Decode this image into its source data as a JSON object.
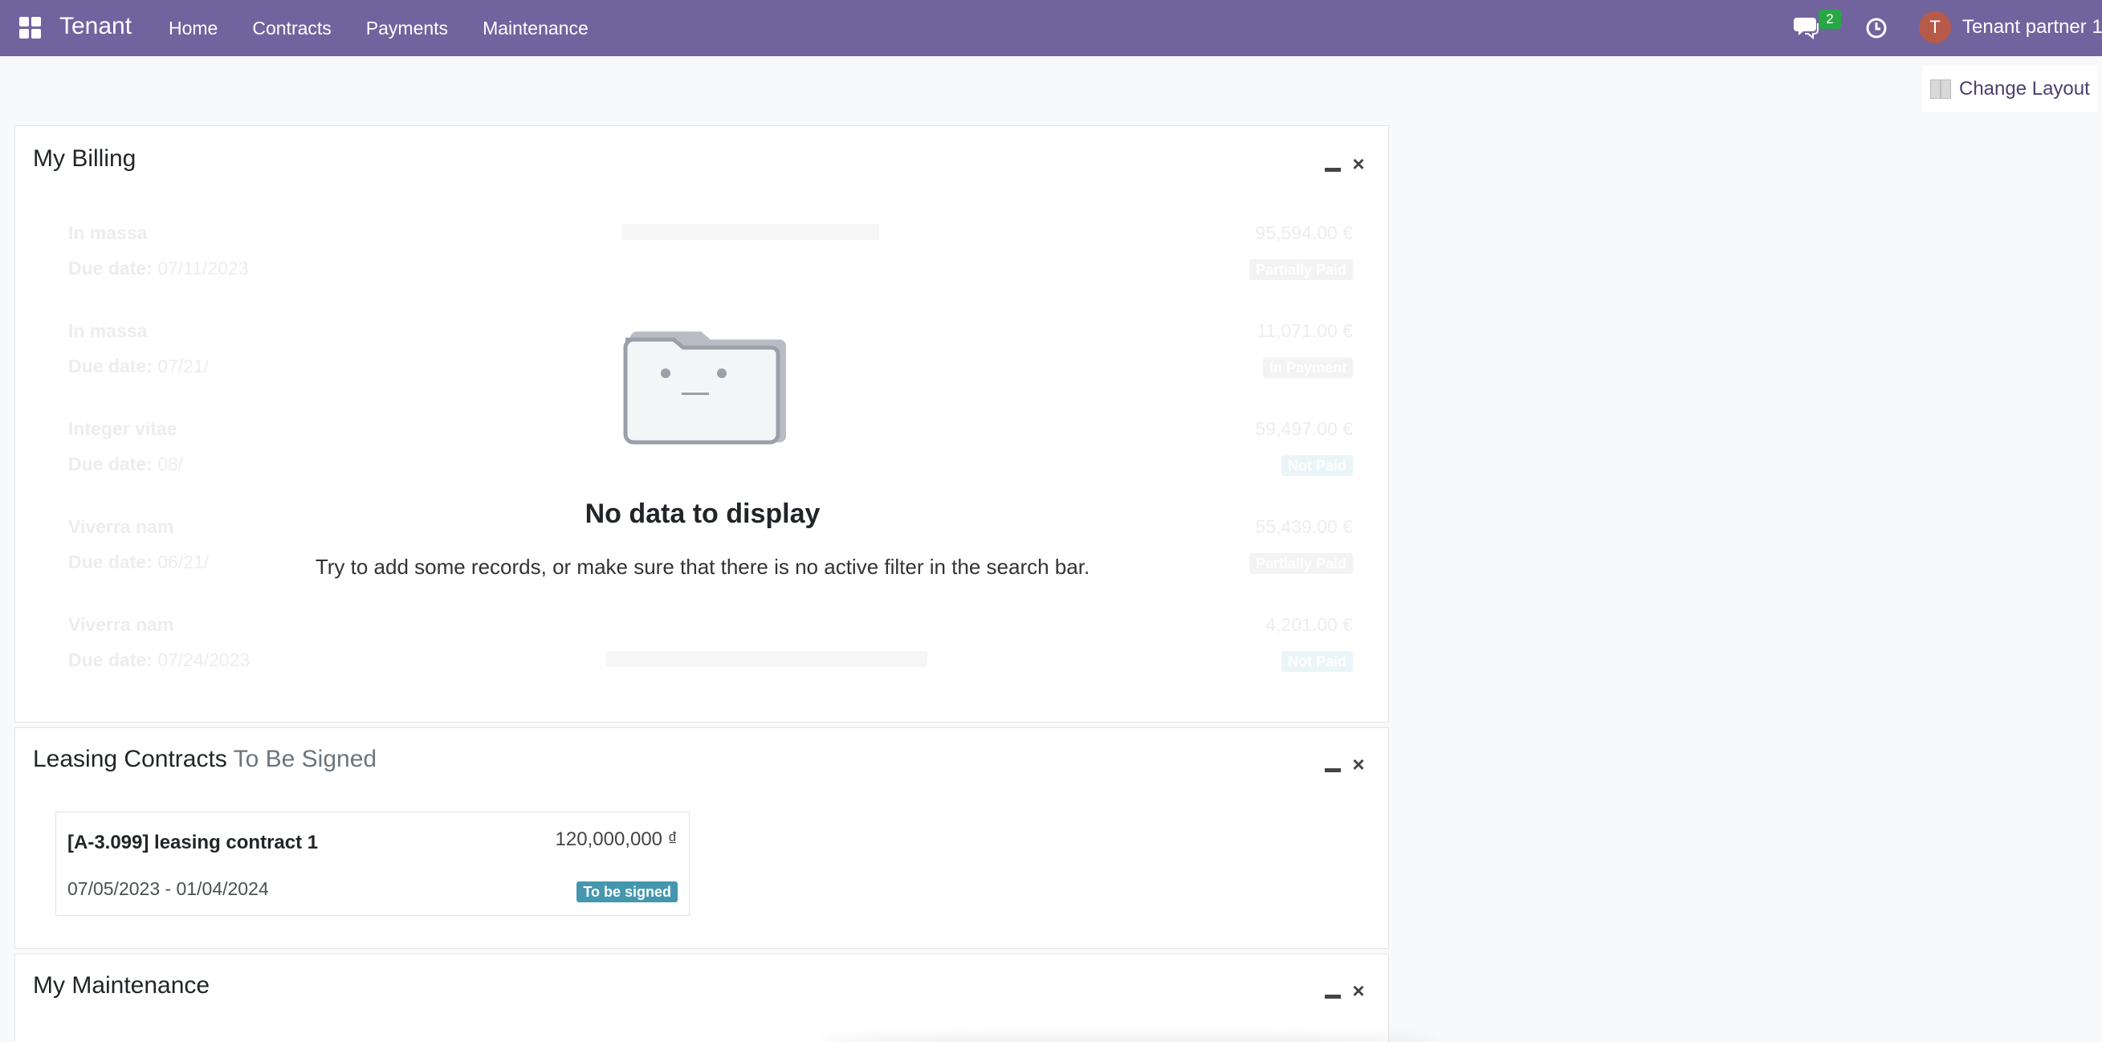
{
  "navbar": {
    "brand": "Tenant",
    "menu": [
      "Home",
      "Contracts",
      "Payments",
      "Maintenance"
    ],
    "chat_count": "2",
    "avatar_initial": "T",
    "user_name": "Tenant partner 1",
    "colors": {
      "navbar": "#71639e",
      "badge": "#28a745",
      "avatar": "#b65a4a"
    }
  },
  "change_layout": {
    "label": "Change Layout"
  },
  "billing": {
    "title": "My Billing",
    "rows": [
      {
        "name": "In massa",
        "due_label": "Due date:",
        "due": "07/11/2023",
        "amount": "95,594.00 €",
        "status": "Partially Paid"
      },
      {
        "name": "In massa",
        "due_label": "Due date:",
        "due": "07/21/",
        "amount": "11,071.00 €",
        "status": "In Payment"
      },
      {
        "name": "Integer vitae",
        "due_label": "Due date:",
        "due": "08/",
        "amount": "59,497.00 €",
        "status": "Not Paid"
      },
      {
        "name": "Viverra nam",
        "due_label": "Due date:",
        "due": "06/21/",
        "amount": "55,439.00 €",
        "status": "Partially Paid"
      },
      {
        "name": "Viverra nam",
        "due_label": "Due date:",
        "due": "07/24/2023",
        "amount": "4,201.00 €",
        "status": "Not Paid"
      }
    ],
    "empty_title": "No data to display",
    "empty_text": "Try to add some records, or make sure that there is no active filter in the search bar."
  },
  "contracts": {
    "title_main": "Leasing Contracts",
    "title_muted": "To Be Signed",
    "card": {
      "name": "[A-3.099] leasing contract 1",
      "amount": "120,000,000 ₫",
      "dates": "07/05/2023 - 01/04/2024",
      "status": "To be signed",
      "status_color": "#4497ae"
    }
  },
  "maintenance": {
    "title": "My Maintenance"
  }
}
